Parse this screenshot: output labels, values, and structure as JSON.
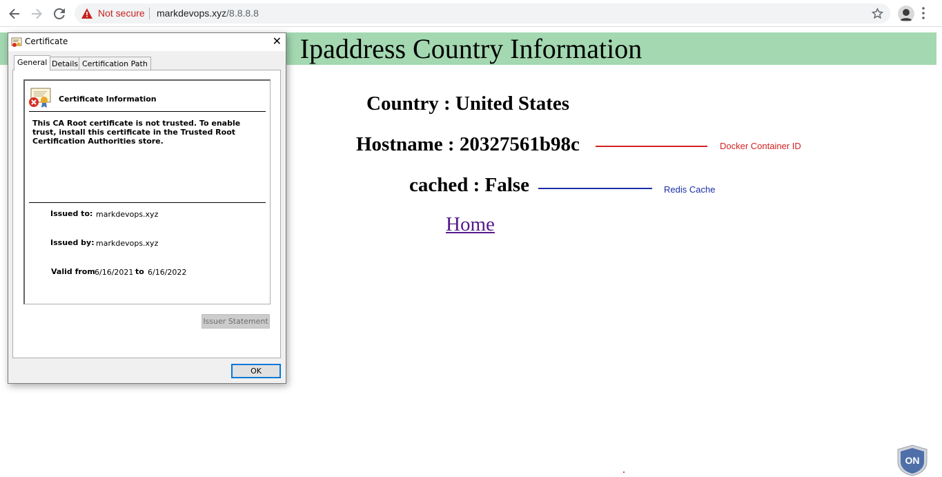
{
  "browser": {
    "security_label": "Not secure",
    "url_domain": "markdevops.xyz",
    "url_path": "/8.8.8.8"
  },
  "page": {
    "title": "Ipaddress Country Information",
    "country_line": "Country : United States",
    "hostname_line": "Hostname : 20327561b98c",
    "cached_line": "cached : False",
    "home_link": "Home"
  },
  "annotations": {
    "docker": {
      "label": "Docker Container ID",
      "color": "#d32020"
    },
    "redis": {
      "label": "Redis Cache",
      "color": "#1a2ea8"
    }
  },
  "badge": {
    "label": "ON"
  },
  "certificate_dialog": {
    "title": "Certificate",
    "tabs": [
      "General",
      "Details",
      "Certification Path"
    ],
    "active_tab": "General",
    "heading": "Certificate Information",
    "message": "This CA Root certificate is not trusted. To enable trust, install this certificate in the Trusted Root Certification Authorities store.",
    "issued_to_label": "Issued to:",
    "issued_to": "markdevops.xyz",
    "issued_by_label": "Issued by:",
    "issued_by": "markdevops.xyz",
    "valid_from_label": "Valid from",
    "valid_from": "6/16/2021",
    "to_label": "to",
    "valid_to": "6/16/2022",
    "issuer_statement_button": "Issuer Statement",
    "ok_button": "OK"
  }
}
